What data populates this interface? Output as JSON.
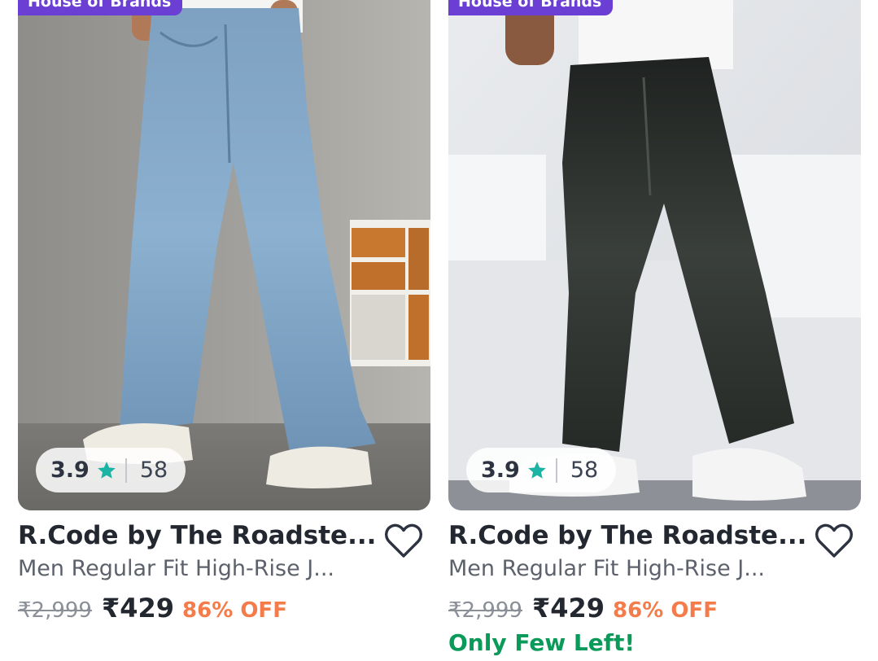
{
  "products": [
    {
      "badge": "House of Brands",
      "rating": "3.9",
      "rating_count": "58",
      "title": "R.Code by The Roadste...",
      "subtitle": "Men Regular Fit High-Rise J...",
      "mrp": "₹2,999",
      "price": "₹429",
      "discount": "86% OFF",
      "stock_note": "",
      "image_icon": "light-blue-wide-leg-jeans-photo"
    },
    {
      "badge": "House of Brands",
      "rating": "3.9",
      "rating_count": "58",
      "title": "R.Code by The Roadste...",
      "subtitle": "Men Regular Fit High-Rise J...",
      "mrp": "₹2,999",
      "price": "₹429",
      "discount": "86% OFF",
      "stock_note": "Only Few Left!",
      "image_icon": "black-relaxed-jeans-photo"
    }
  ],
  "icons": {
    "star": "star-icon",
    "wishlist": "heart-outline-icon"
  },
  "colors": {
    "badge": "#6b3fd4",
    "star": "#1bb4a4",
    "discount": "#f47c4a",
    "stock_note": "#0a9a5a"
  }
}
